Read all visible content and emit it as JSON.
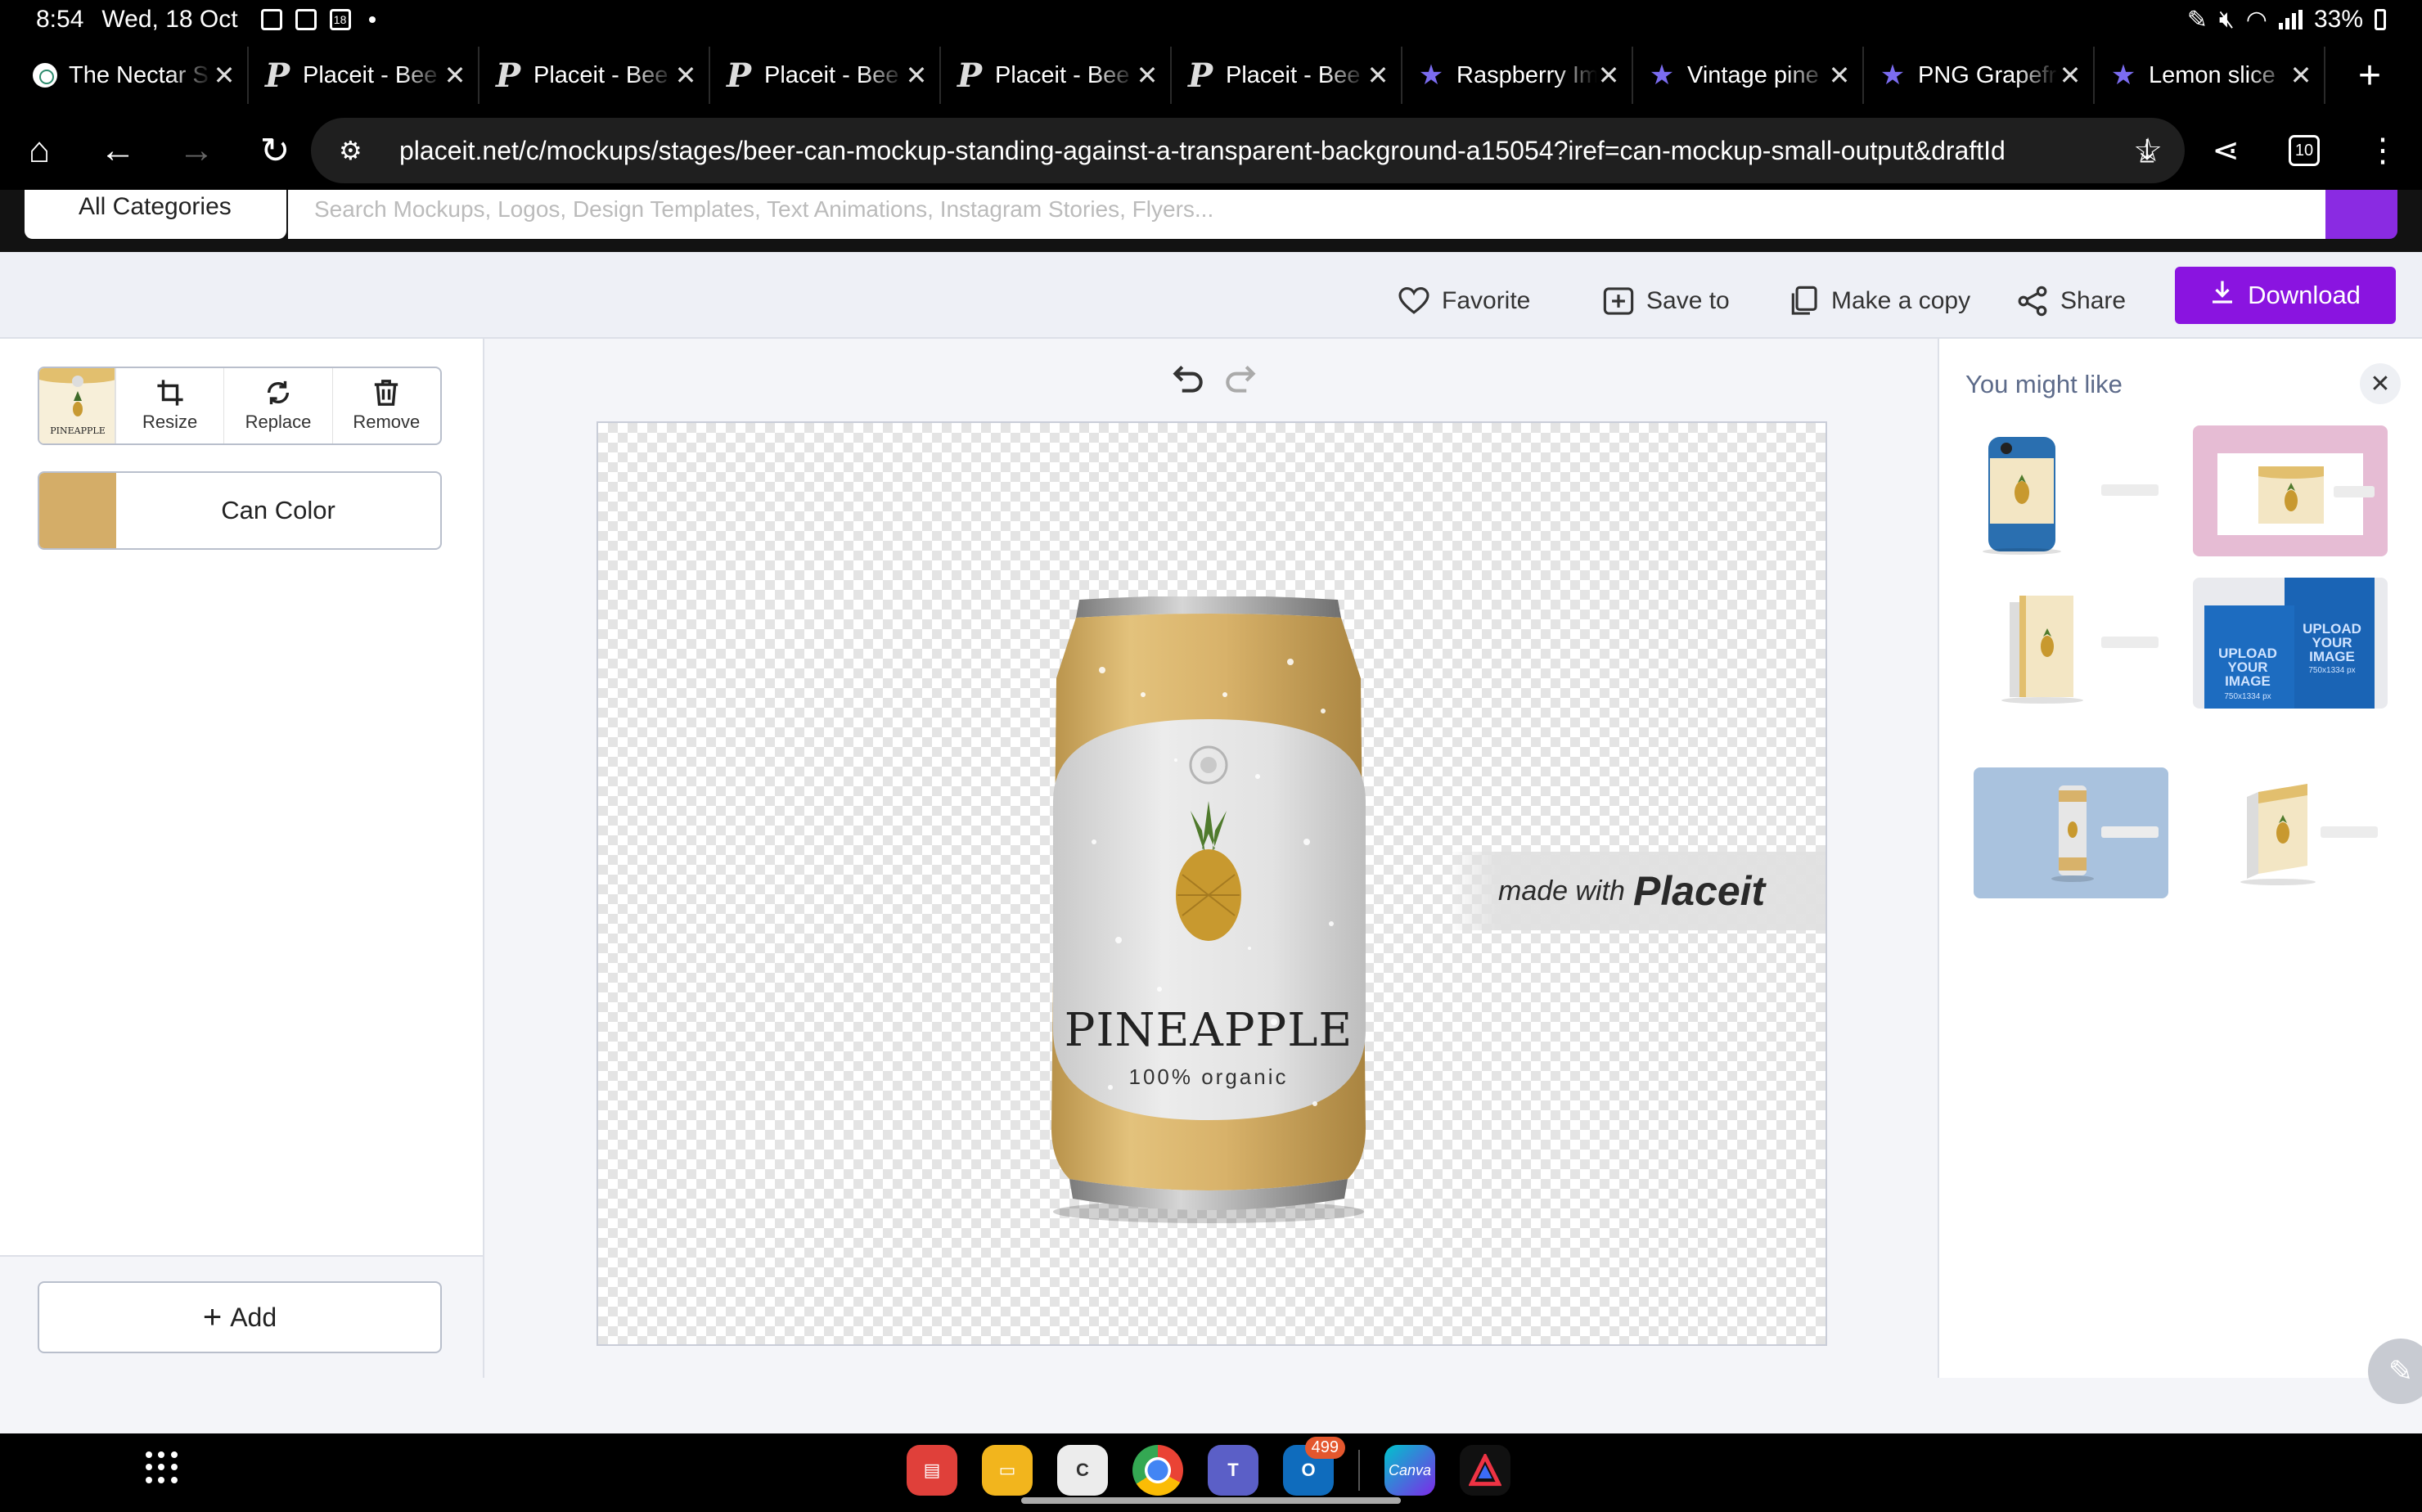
{
  "status_bar": {
    "time": "8:54",
    "date": "Wed, 18 Oct",
    "notif_badge": "18",
    "battery": "33%"
  },
  "tabs": [
    {
      "title": "The Nectar S",
      "icon": "chatgpt-icon"
    },
    {
      "title": "Placeit - Bee",
      "icon": "placeit-icon"
    },
    {
      "title": "Placeit - Bee",
      "icon": "placeit-icon"
    },
    {
      "title": "Placeit - Bee",
      "icon": "placeit-icon"
    },
    {
      "title": "Placeit - Bee",
      "icon": "placeit-icon"
    },
    {
      "title": "Placeit - Bee",
      "icon": "placeit-icon"
    },
    {
      "title": "Raspberry Im",
      "icon": "star-icon"
    },
    {
      "title": "Vintage pine",
      "icon": "star-icon"
    },
    {
      "title": "PNG Grapefr",
      "icon": "star-icon"
    },
    {
      "title": "Lemon slice",
      "icon": "star-icon"
    }
  ],
  "address_bar": {
    "url": "placeit.net/c/mockups/stages/beer-can-mockup-standing-against-a-transparent-background-a15054?iref=can-mockup-small-output&draftId",
    "tab_count": "10"
  },
  "site_search": {
    "category": "All Categories",
    "placeholder": "Search Mockups, Logos, Design Templates, Text Animations, Instagram Stories, Flyers..."
  },
  "toolbar": {
    "favorite": "Favorite",
    "save_to": "Save to",
    "make_copy": "Make a copy",
    "share": "Share",
    "download": "Download",
    "accent": "#8a14e0"
  },
  "left_panel": {
    "layer_actions": {
      "resize": "Resize",
      "replace": "Replace",
      "remove": "Remove"
    },
    "thumb_text": "PINEAPPLE",
    "can_color_label": "Can Color",
    "can_color": "#d4ad68",
    "add_label": "Add"
  },
  "canvas": {
    "label_title": "PINEAPPLE",
    "label_sub": "100% organic",
    "watermark_pre": "made with",
    "watermark_brand": "Placeit"
  },
  "right_panel": {
    "title": "You might like",
    "upload_a": "UPLOAD YOUR IMAGE",
    "upload_a_size": "750x1334 px",
    "upload_b": "UPLOAD YOUR IMAGE",
    "upload_b_size": "750x1334 px"
  },
  "taskbar": {
    "outlook_badge": "499",
    "canva_label": "Canva"
  }
}
